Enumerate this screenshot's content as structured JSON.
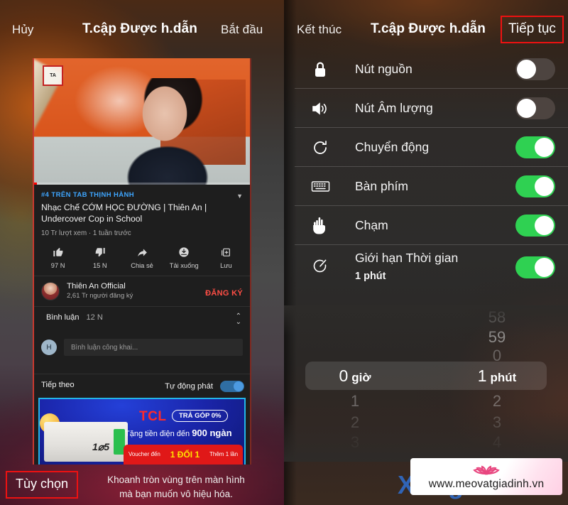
{
  "left_panel": {
    "topbar": {
      "cancel_label": "Hủy",
      "title": "T.cập Được h.dẫn",
      "start_label": "Bắt đầu"
    },
    "video": {
      "watermark_stamp": "Thiên An",
      "trend_badge": "#4 TRÊN TAB THỊNH HÀNH",
      "title": "Nhạc Chế CỚM HỌC ĐƯỜNG | Thiên An | Undercover Cop in School",
      "stats": "10 Tr lượt xem · 1 tuần trước"
    },
    "actions": [
      {
        "icon": "thumbs-up-icon",
        "label": "97 N"
      },
      {
        "icon": "thumbs-down-icon",
        "label": "15 N"
      },
      {
        "icon": "share-icon",
        "label": "Chia sẻ"
      },
      {
        "icon": "download-icon",
        "label": "Tải xuống"
      },
      {
        "icon": "save-icon",
        "label": "Lưu"
      }
    ],
    "channel": {
      "name": "Thiên An Official",
      "subscribers": "2,61 Tr người đăng ký",
      "subscribe_label": "ĐĂNG KÝ"
    },
    "comments": {
      "heading": "Bình luận",
      "count": "12 N",
      "avatar_initial": "H",
      "input_placeholder": "Bình luận công khai..."
    },
    "next_up": {
      "label": "Tiếp theo",
      "autoplay_label": "Tự động phát",
      "autoplay_on": true
    },
    "ad": {
      "brand": "TCL",
      "pill": "TRẢ GÓP 0%",
      "headline": "Tặng tiền điện đến ",
      "headline_amount": "900 ngàn",
      "fridge_number": "1⌀5",
      "voucher_left": "Voucher đến",
      "voucher_big": "1 ĐỔI 1",
      "voucher_right": "Thêm 1 lần"
    },
    "bottom": {
      "options_label": "Tùy chọn",
      "instruction_line1": "Khoanh tròn vùng trên màn hình",
      "instruction_line2": "mà bạn muốn vô hiệu hóa."
    }
  },
  "right_panel": {
    "topbar": {
      "end_label": "Kết thúc",
      "title": "T.cập Được h.dẫn",
      "continue_label": "Tiếp tục",
      "continue_highlight_color": "#ee1111"
    },
    "settings": [
      {
        "icon": "lock-icon",
        "label": "Nút nguồn",
        "value": "",
        "enabled": false
      },
      {
        "icon": "speaker-icon",
        "label": "Nút Âm lượng",
        "value": "",
        "enabled": false
      },
      {
        "icon": "rotate-icon",
        "label": "Chuyển động",
        "value": "",
        "enabled": true
      },
      {
        "icon": "keyboard-icon",
        "label": "Bàn phím",
        "value": "",
        "enabled": true
      },
      {
        "icon": "touch-icon",
        "label": "Chạm",
        "value": "",
        "enabled": true
      },
      {
        "icon": "timer-icon",
        "label": "Giới hạn Thời gian",
        "value": "1 phút",
        "enabled": true
      }
    ],
    "time_picker": {
      "hours": {
        "above": [
          "",
          "",
          ""
        ],
        "selected_value": "0",
        "selected_unit": "giờ",
        "below": [
          "1",
          "2",
          "3"
        ]
      },
      "minutes": {
        "above": [
          "58",
          "59",
          "0"
        ],
        "selected_value": "1",
        "selected_unit": "phút",
        "below": [
          "2",
          "3",
          "4"
        ]
      }
    }
  },
  "watermark": {
    "ghost_text": "Xong",
    "url": "www.meovatgiadinh.vn",
    "logo_icon": "lotus-icon"
  },
  "colors": {
    "toggle_on": "#2fd152",
    "toggle_off": "#4d4440",
    "highlight_border": "#ee1111",
    "link_blue": "#3ea6ff",
    "subscribe_red": "#ff4e45"
  }
}
